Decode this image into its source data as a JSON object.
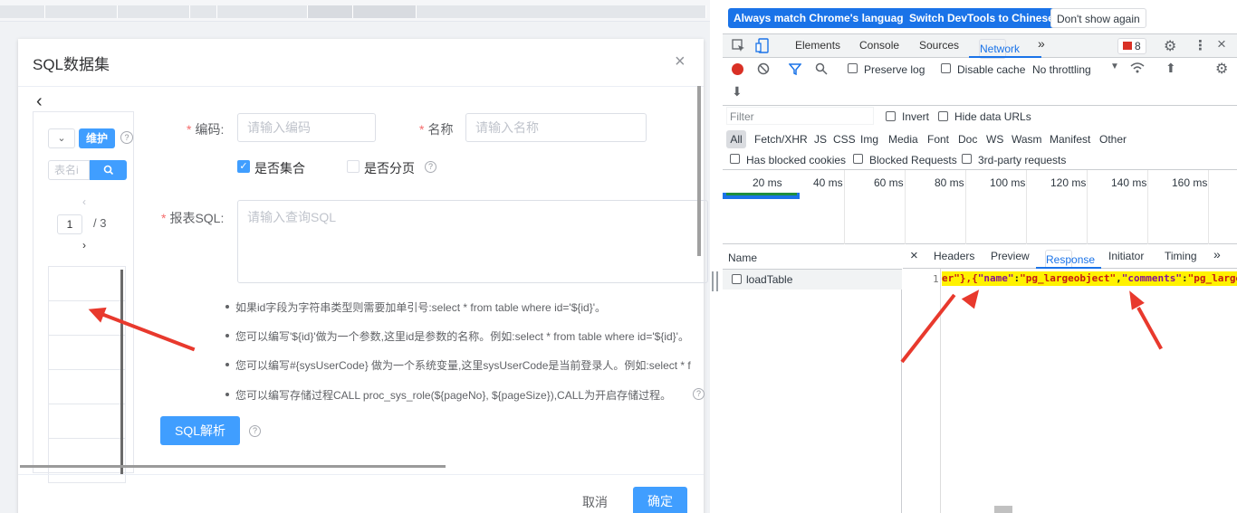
{
  "dialog": {
    "title": "SQL数据集",
    "close_icon": "×",
    "back_icon": "‹",
    "panel": {
      "select_icon": "⌄",
      "maintain_label": "维护",
      "help_icon": "?",
      "table_placeholder": "表名i",
      "search_icon": "⌕",
      "prev_icon": "‹",
      "page_current": "1",
      "page_total": "/   3",
      "next_icon": "›"
    },
    "form": {
      "code_label": "编码:",
      "code_placeholder": "请输入编码",
      "name_label": "名称",
      "name_placeholder": "请输入名称",
      "is_collection_label": "是否集合",
      "is_paged_label": "是否分页",
      "sql_label": "报表SQL:",
      "sql_placeholder": "请输入查询SQL",
      "required_mark": "*"
    },
    "hints": [
      "如果id字段为字符串类型则需要加单引号:select * from table where id='${id}'。",
      "您可以编写'${id}'做为一个参数,这里id是参数的名称。例如:select * from table where id='${id}'。",
      "您可以编写#{sysUserCode} 做为一个系统变量,这里sysUserCode是当前登录人。例如:select * f",
      "您可以编写存储过程CALL proc_sys_role(${pageNo}, ${pageSize}),CALL为开启存储过程。"
    ],
    "sql_parse_label": "SQL解析",
    "cancel_label": "取消",
    "ok_label": "确定"
  },
  "devtools": {
    "infobar": {
      "match_language": "Always match Chrome's language",
      "switch_chinese": "Switch DevTools to Chinese",
      "dont_show": "Don't show again"
    },
    "tabs": [
      "Elements",
      "Console",
      "Sources",
      "Network"
    ],
    "more_tabs_icon": "»",
    "issues_count": "8",
    "toolbar": {
      "preserve_log": "Preserve log",
      "disable_cache": "Disable cache",
      "throttling": "No throttling"
    },
    "filter": {
      "placeholder": "Filter",
      "invert": "Invert",
      "hide_data_urls": "Hide data URLs",
      "types": [
        "All",
        "Fetch/XHR",
        "JS",
        "CSS",
        "Img",
        "Media",
        "Font",
        "Doc",
        "WS",
        "Wasm",
        "Manifest",
        "Other"
      ],
      "has_blocked_cookies": "Has blocked cookies",
      "blocked_requests": "Blocked Requests",
      "third_party": "3rd-party requests"
    },
    "timeline_ticks": [
      "20 ms",
      "40 ms",
      "60 ms",
      "80 ms",
      "100 ms",
      "120 ms",
      "140 ms",
      "160 ms"
    ],
    "name_header": "Name",
    "request_name": "loadTable",
    "detail_tabs": [
      "Headers",
      "Preview",
      "Response",
      "Initiator",
      "Timing"
    ],
    "close_icon": "×",
    "line_number": "1",
    "response_line": {
      "t1": "er\"},{",
      "t2": "\"name\"",
      "t3": ":",
      "t4": "\"pg_largeobject\"",
      "t5": ",",
      "t6": "\"comments\"",
      "t7": ":",
      "t8": "\"pg_large"
    }
  }
}
